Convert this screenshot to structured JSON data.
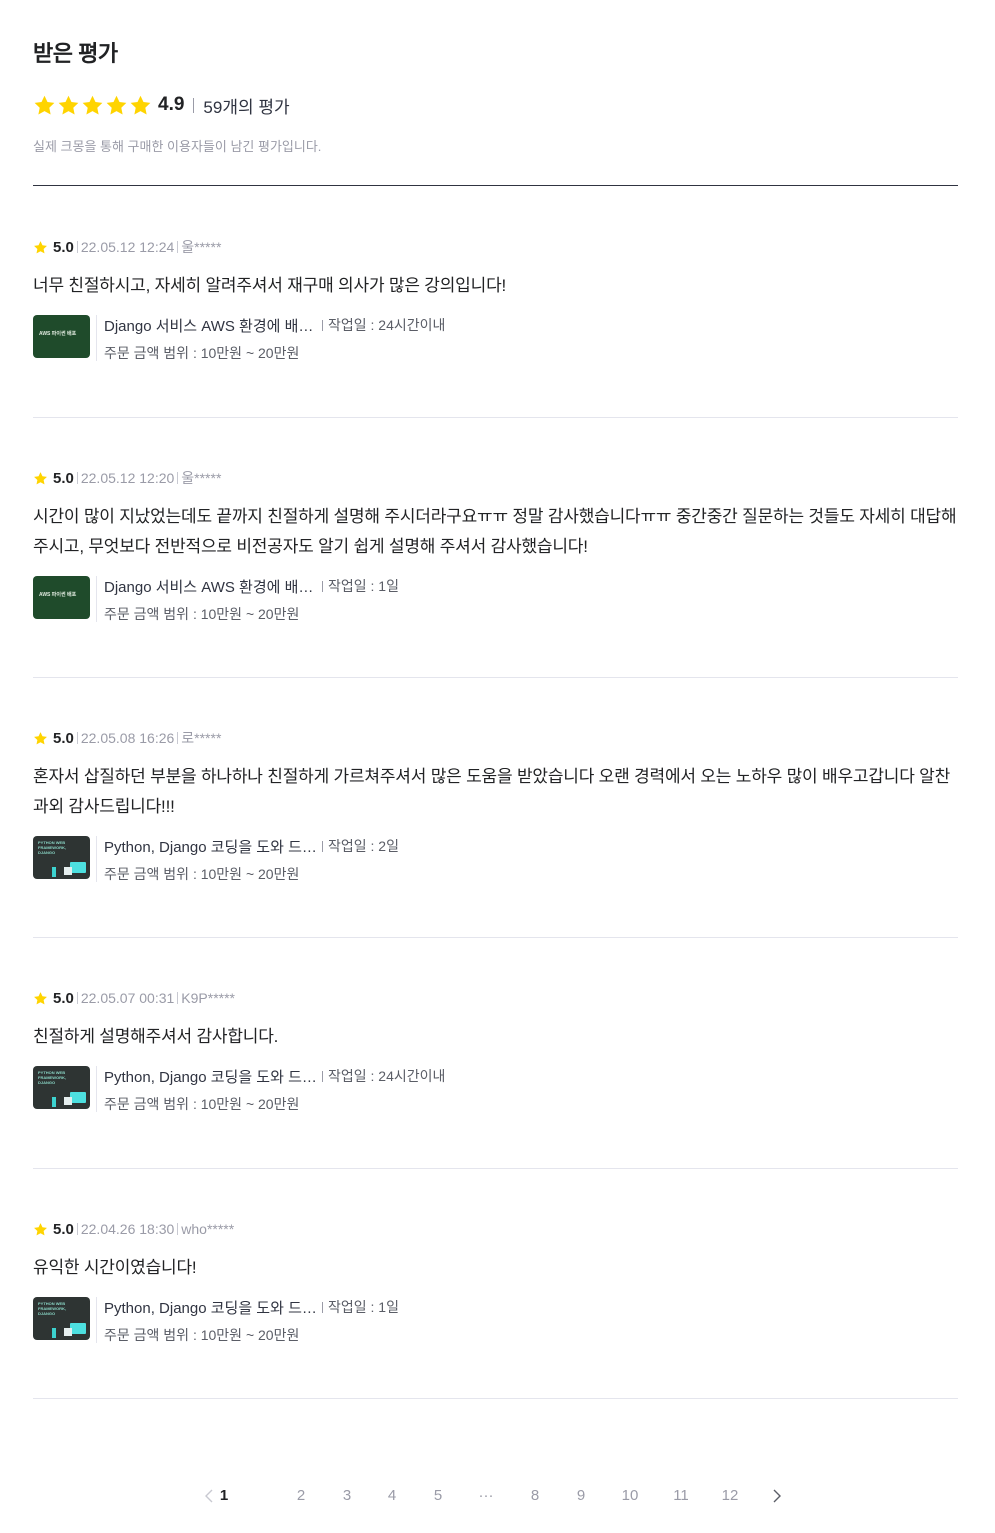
{
  "header": {
    "title": "받은 평가",
    "average": "4.9",
    "count_label": "59개의 평가",
    "notice": "실제 크몽을 통해 구매한 이용자들이 남긴 평가입니다."
  },
  "colors": {
    "star": "#FFD400",
    "text": "#212224",
    "muted": "#9a9ba7"
  },
  "reviews": [
    {
      "score": "5.0",
      "date": "22.05.12 12:24",
      "user": "울*****",
      "text": "너무 친절하시고, 자세히 알려주셔서 재구매 의사가 많은 강의입니다!",
      "service_name": "Django 서비스 AWS 환경에 배포해 드립니다.",
      "work": "작업일 : 24시간이내",
      "price": "주문 금액 범위 : 10만원 ~ 20만원",
      "thumb": "AWS 파이썬 배포"
    },
    {
      "score": "5.0",
      "date": "22.05.12 12:20",
      "user": "울*****",
      "text": "시간이 많이 지났었는데도 끝까지 친절하게 설명해 주시더라구요ㅠㅠ 정말 감사했습니다ㅠㅠ 중간중간 질문하는 것들도 자세히 대답해 주시고, 무엇보다 전반적으로 비전공자도 알기 쉽게 설명해 주셔서 감사했습니다!",
      "service_name": "Django 서비스 AWS 환경에 배포해 드립니다.",
      "work": "작업일 : 1일",
      "price": "주문 금액 범위 : 10만원 ~ 20만원",
      "thumb": "AWS 파이썬 배포"
    },
    {
      "score": "5.0",
      "date": "22.05.08 16:26",
      "user": "로*****",
      "text": "혼자서 삽질하던 부분을 하나하나 친절하게 가르쳐주셔서 많은 도움을 받았습니다 오랜 경력에서 오는 노하우 많이 배우고갑니다 알찬 과외 감사드립니다!!!",
      "service_name": "Python, Django 코딩을 도와 드립니다.",
      "work": "작업일 : 2일",
      "price": "주문 금액 범위 : 10만원 ~ 20만원",
      "thumb": "PYTHON WEB FRAMEWORK, DJANGO"
    },
    {
      "score": "5.0",
      "date": "22.05.07 00:31",
      "user": "K9P*****",
      "text": "친절하게 설명해주셔서 감사합니다.",
      "service_name": "Python, Django 코딩을 도와 드립니다.",
      "work": "작업일 : 24시간이내",
      "price": "주문 금액 범위 : 10만원 ~ 20만원",
      "thumb": "PYTHON WEB FRAMEWORK, DJANGO"
    },
    {
      "score": "5.0",
      "date": "22.04.26 18:30",
      "user": "who*****",
      "text": "유익한 시간이였습니다!",
      "service_name": "Python, Django 코딩을 도와 드립니다.",
      "work": "작업일 : 1일",
      "price": "주문 금액 범위 : 10만원 ~ 20만원",
      "thumb": "PYTHON WEB FRAMEWORK, DJANGO"
    }
  ],
  "pagination": {
    "pages": [
      "1",
      "2",
      "3",
      "4",
      "5",
      "···",
      "8",
      "9",
      "10",
      "11",
      "12"
    ],
    "current": "1",
    "prev_icon": "chevron-left-icon",
    "next_icon": "chevron-right-icon"
  }
}
